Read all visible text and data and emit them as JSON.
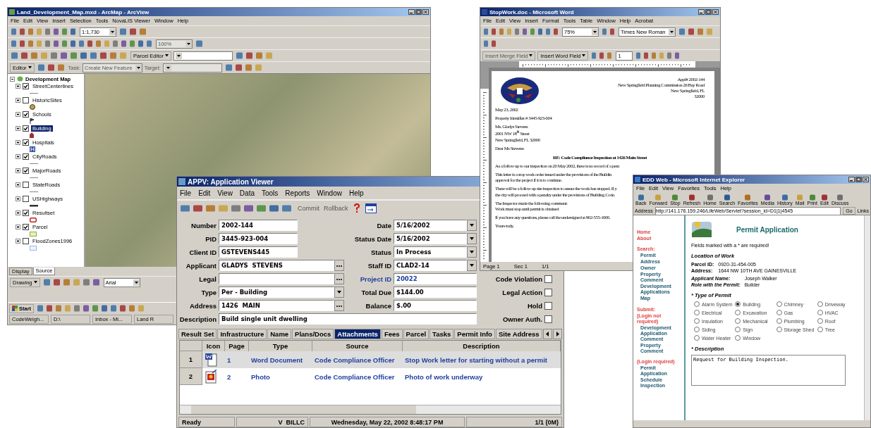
{
  "arcmap": {
    "title": "Land_Development_Map.mxd - ArcMap - ArcView",
    "menu": [
      "File",
      "Edit",
      "View",
      "Insert",
      "Selection",
      "Tools",
      "NovaLIS Viewer",
      "Window",
      "Help"
    ],
    "scale": "1:1,730",
    "zoom_percent": "100%",
    "parcel_editor": "Parcel Editor",
    "editor": "Editor",
    "task_label": "Task:",
    "task": "Create New Feature",
    "target_label": "Target:",
    "toc_root": "Development Map",
    "layers": [
      {
        "name": "StreetCenterlines",
        "checked": true,
        "selected": false,
        "kind": "line"
      },
      {
        "name": "HistoricSites",
        "checked": false,
        "selected": false,
        "kind": "marker"
      },
      {
        "name": "Schools",
        "checked": true,
        "selected": false,
        "kind": "flag"
      },
      {
        "name": "Building",
        "checked": true,
        "selected": true,
        "kind": "building"
      },
      {
        "name": "Hospitals",
        "checked": true,
        "selected": false,
        "kind": "hospital"
      },
      {
        "name": "CityRoads",
        "checked": true,
        "selected": false,
        "kind": "line"
      },
      {
        "name": "MajorRoads",
        "checked": true,
        "selected": false,
        "kind": "line"
      },
      {
        "name": "StateRoads",
        "checked": false,
        "selected": false,
        "kind": "line"
      },
      {
        "name": "USHighways",
        "checked": false,
        "selected": false,
        "kind": "thickline"
      },
      {
        "name": "Resultset",
        "checked": true,
        "selected": false,
        "kind": "redbox"
      },
      {
        "name": "Parcel",
        "checked": true,
        "selected": false,
        "kind": "greenbox"
      },
      {
        "name": "FloodZones1996",
        "checked": false,
        "selected": false,
        "kind": "bluebox"
      }
    ],
    "toc_tabs": [
      {
        "label": "Display",
        "selected": false
      },
      {
        "label": "Source",
        "selected": true
      }
    ],
    "drawing": "Drawing",
    "font": "Arial"
  },
  "taskbar": {
    "start": "Start",
    "items": [
      "CodeWeigh...",
      "D:\\",
      "Inbox - Mi...",
      "Land R"
    ]
  },
  "word": {
    "title": "StopWork.doc - Microsoft Word",
    "menu": [
      "File",
      "Edit",
      "View",
      "Insert",
      "Format",
      "Tools",
      "Table",
      "Window",
      "Help",
      "Acrobat"
    ],
    "zoom": "75%",
    "font": "Times New Roman",
    "merge_field": "Insert Merge Field",
    "word_field": "Insert Word Field",
    "page_no": "1",
    "doc": [
      {
        "kind": "right",
        "text": "Appl# 2002-144"
      },
      {
        "kind": "right",
        "text": "New Springfield Planning Commission  26 Bay Road"
      },
      {
        "kind": "right",
        "text": "New Springfield, FL"
      },
      {
        "kind": "right",
        "text": "32000"
      },
      {
        "kind": "para",
        "text": "May 23, 2002"
      },
      {
        "kind": "para",
        "text": "Property Identifier # 3445-923-004"
      },
      {
        "kind": "para",
        "text": "Ms. Gladys Stevens"
      },
      {
        "kind": "line",
        "text": "2001 NW 18$^{th}$ Street"
      },
      {
        "kind": "line",
        "text": "New Springfield, FL  32000"
      },
      {
        "kind": "para",
        "text": "Dear Ms Stevens:"
      },
      {
        "kind": "heading",
        "text": "RE: Code Compliance Inspection at 1426 Main Street"
      },
      {
        "kind": "para",
        "text": "As a follow up to our inspection on 20 May 2002, there is no record of a pern"
      },
      {
        "kind": "para",
        "text": "This letter is a stop work order issued under the provisions of the Buildin"
      },
      {
        "kind": "line",
        "text": "approval for the project if it is to continue."
      },
      {
        "kind": "para",
        "text": "There will be a follow up site inspection to assure the work has stopped.  If y"
      },
      {
        "kind": "line",
        "text": "the city will proceed with a penalty under the provisions of Building Code."
      },
      {
        "kind": "para",
        "text": "The Inspector made the following comment:"
      },
      {
        "kind": "line",
        "text": "Work must stop until permit is obtained"
      },
      {
        "kind": "para",
        "text": "If you have any questions, please call the undersigned at 902-555-1000."
      },
      {
        "kind": "para",
        "text": "Yours truly,"
      }
    ],
    "status": [
      "Page 1",
      "Sec 1",
      "1/1"
    ]
  },
  "app_viewer": {
    "title": "APPV: Application Viewer",
    "menu": [
      "File",
      "Edit",
      "View",
      "Data",
      "Tools",
      "Reports",
      "Window",
      "Help"
    ],
    "commit": "Commit",
    "rollback": "Rollback",
    "left_fields": [
      {
        "label": "Number",
        "value": "2002-144",
        "kind": "text"
      },
      {
        "label": "PID",
        "value": "3445-923-004",
        "kind": "text"
      },
      {
        "label": "Client ID",
        "value": "GSTEVENS445",
        "kind": "text"
      },
      {
        "label": "Applicant",
        "value": "GLADYS  STEVENS",
        "kind": "lookup"
      },
      {
        "label": "Legal",
        "kind": "lookup"
      },
      {
        "label": "Type",
        "value": "Per - Building",
        "kind": "select"
      },
      {
        "label": "Address",
        "value": "1426  MAIN",
        "kind": "lookup"
      }
    ],
    "right_fields": [
      {
        "label": "Date",
        "value": "5/16/2002",
        "kind": "select"
      },
      {
        "label": "Status Date",
        "value": "5/16/2002",
        "kind": "select"
      },
      {
        "label": "Status",
        "value": "In Process",
        "kind": "select"
      },
      {
        "label": "Staff ID",
        "value": "CLAD2-14",
        "kind": "select"
      },
      {
        "label": "Project ID",
        "value": "20022",
        "kind": "link"
      },
      {
        "label": "Total Due",
        "value": "$144.00",
        "kind": "text"
      },
      {
        "label": "Balance",
        "value": "$.00",
        "kind": "text"
      }
    ],
    "flags": [
      {
        "label": "Code Violation",
        "checked": false
      },
      {
        "label": "Legal Action",
        "checked": false
      },
      {
        "label": "Hold",
        "checked": false
      },
      {
        "label": "Owner Auth.",
        "checked": false
      }
    ],
    "description": {
      "label": "Description",
      "value": "Build single unit dwelling"
    },
    "tabs": [
      {
        "label": "Result Set",
        "selected": false
      },
      {
        "label": "Infrastructure",
        "selected": false
      },
      {
        "label": "Name",
        "selected": false
      },
      {
        "label": "Plans/Docs",
        "selected": false
      },
      {
        "label": "Attachments",
        "selected": true
      },
      {
        "label": "Fees",
        "selected": false
      },
      {
        "label": "Parcel",
        "selected": false
      },
      {
        "label": "Tasks",
        "selected": false
      },
      {
        "label": "Permit Info",
        "selected": false
      },
      {
        "label": "Site Address",
        "selected": false
      }
    ],
    "columns": [
      "Icon",
      "Page",
      "Type",
      "Source",
      "Description"
    ],
    "rows": [
      {
        "number": "1",
        "kind": "word",
        "page": "1",
        "type": "Word Document",
        "source": "Code Compliance Officer",
        "description": "Stop Work letter for starting without a permit",
        "selected": true
      },
      {
        "number": "2",
        "kind": "photo",
        "page": "2",
        "type": "Photo",
        "source": "Code Compliance Officer",
        "description": "Photo of work underway",
        "selected": false
      }
    ],
    "status": [
      "Ready",
      "V  BILLC",
      "Wednesday, May 22, 2002 8:48:17 PM",
      "1/1 (0M)"
    ]
  },
  "browser": {
    "title": "EDD Web - Microsoft Internet Explorer",
    "menu": [
      "File",
      "Edit",
      "View",
      "Favorites",
      "Tools",
      "Help"
    ],
    "toolbar": [
      "Back",
      "Forward",
      "Stop",
      "Refresh",
      "Home",
      "Search",
      "Favorites",
      "Media",
      "History",
      "Mail",
      "Print",
      "Edit",
      "Discuss"
    ],
    "address_label": "Address",
    "address": "http://141.176.159.246/LifeWeb/Servlet?session_id=D1|1|4545",
    "go": "Go",
    "links": "Links",
    "nav": [
      {
        "text": "Home",
        "kind": "link"
      },
      {
        "text": "About",
        "kind": "link"
      },
      {
        "text": "Search:",
        "kind": "header"
      },
      {
        "text": "Permit",
        "kind": "item"
      },
      {
        "text": "Address",
        "kind": "item"
      },
      {
        "text": "Owner",
        "kind": "item"
      },
      {
        "text": "Property Comment",
        "kind": "item"
      },
      {
        "text": "Development Applications",
        "kind": "item"
      },
      {
        "text": "Map",
        "kind": "item"
      },
      {
        "text": "Submit:",
        "kind": "header"
      },
      {
        "text": "(Login not required)",
        "kind": "note"
      },
      {
        "text": "Development Application Comment",
        "kind": "item"
      },
      {
        "text": "Property Comment",
        "kind": "item"
      },
      {
        "text": "(Login required)",
        "kind": "header"
      },
      {
        "text": "Permit Application",
        "kind": "item"
      },
      {
        "text": "Schedule Inspection",
        "kind": "item"
      }
    ],
    "heading": "Permit Application",
    "required_note": "Fields marked with a * are required!",
    "location_heading": "Location of Work",
    "info": [
      {
        "label": "Parcel ID:",
        "value": "0920-31-454-005"
      },
      {
        "label": "Address:",
        "value": "1644 NW 10TH AVE GAINESVILLE"
      }
    ],
    "applicant": [
      {
        "label": "Applicant Name:",
        "value": "Joseph Walker"
      },
      {
        "label": "Role with the Permit:",
        "value": "Builder"
      }
    ],
    "type_heading": "* Type of Permit",
    "options": [
      {
        "label": "Alarm System",
        "selected": false
      },
      {
        "label": "Building",
        "selected": true
      },
      {
        "label": "Chimney",
        "selected": false
      },
      {
        "label": "Driveway",
        "selected": false
      },
      {
        "label": "Electrical",
        "selected": false
      },
      {
        "label": "Excavation",
        "selected": false
      },
      {
        "label": "Gas",
        "selected": false
      },
      {
        "label": "HVAC",
        "selected": false
      },
      {
        "label": "Insulation",
        "selected": false
      },
      {
        "label": "Mechanical",
        "selected": false
      },
      {
        "label": "Plumbing",
        "selected": false
      },
      {
        "label": "Roof",
        "selected": false
      },
      {
        "label": "Siding",
        "selected": false
      },
      {
        "label": "Sign",
        "selected": false
      },
      {
        "label": "Storage Shed",
        "selected": false
      },
      {
        "label": "Tree",
        "selected": false
      },
      {
        "label": "Water Heater",
        "selected": false
      },
      {
        "label": "Window",
        "selected": false
      }
    ],
    "description_heading": "* Description",
    "description": "Request for Building Inspection."
  }
}
